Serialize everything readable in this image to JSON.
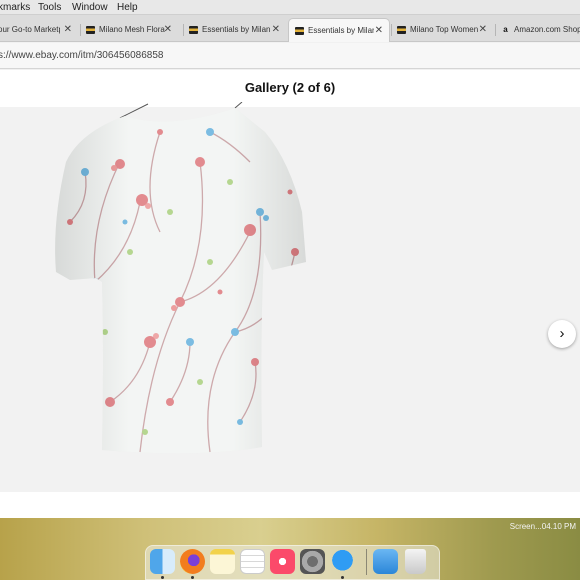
{
  "menubar": {
    "items": [
      "kmarks",
      "Tools",
      "Window",
      "Help"
    ]
  },
  "tabs": [
    {
      "title": "our Go-to Marketp",
      "active": false
    },
    {
      "title": "Milano Mesh Floral",
      "active": false
    },
    {
      "title": "Essentials by Milano",
      "active": false
    },
    {
      "title": "Essentials by Milano",
      "active": true
    },
    {
      "title": "Milano Top Women",
      "active": false
    },
    {
      "title": "Amazon.com Shopp",
      "active": false
    }
  ],
  "close_glyph": "✕",
  "url": "s://www.ebay.com/itm/306456086858",
  "gallery": {
    "title": "Gallery (2 of 6)",
    "next_glyph": "›"
  },
  "screenshot_label": "Screen...04.10 PM",
  "dock": {
    "apps": [
      "finder-icon",
      "firefox-icon",
      "notes-icon",
      "reminders-icon",
      "music-icon",
      "system-preferences-icon",
      "messages-icon",
      "downloads-folder-icon",
      "trash-icon"
    ]
  },
  "colors": {
    "shirt_base": "#e9ecea",
    "floral_red": "#d9646a",
    "floral_blue": "#4fa6d8",
    "floral_green": "#9cc96b",
    "branch": "#b47b7f"
  }
}
